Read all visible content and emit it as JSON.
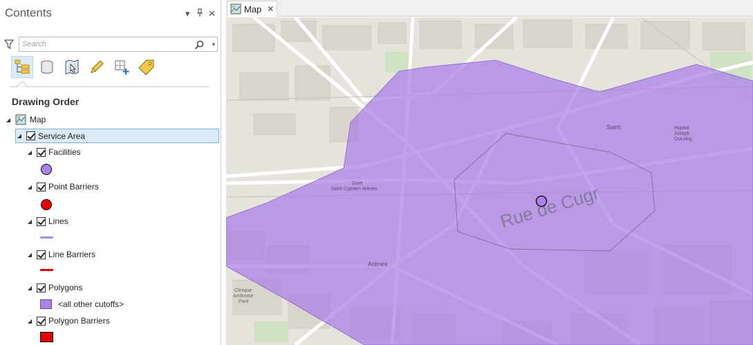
{
  "contents": {
    "title": "Contents",
    "controls": {
      "menu": "▾",
      "pin": "📌",
      "close": "✕"
    },
    "search": {
      "placeholder": "Search",
      "value": ""
    },
    "toolbar": [
      {
        "name": "list-by-drawing-order-icon",
        "active": true
      },
      {
        "name": "list-by-data-source-icon",
        "active": false
      },
      {
        "name": "list-by-selection-icon",
        "active": false
      },
      {
        "name": "list-by-editing-icon",
        "active": false
      },
      {
        "name": "list-by-snapping-icon",
        "active": false
      },
      {
        "name": "list-by-labeling-icon",
        "active": false
      }
    ],
    "heading": "Drawing Order",
    "tree": {
      "map": "Map",
      "service_area": "Service Area",
      "facilities": "Facilities",
      "point_barriers": "Point Barriers",
      "lines": "Lines",
      "line_barriers": "Line Barriers",
      "polygons": "Polygons",
      "polygons_class": "<all other cutoffs>",
      "polygon_barriers": "Polygon Barriers"
    }
  },
  "map_tab": {
    "label": "Map",
    "close": "✕"
  },
  "map": {
    "street_labels": {
      "rue_de_cugr": "Rue de Cugr",
      "saint": "Saint",
      "hopital": "Hopital",
      "joseph": "Joseph",
      "ducuing": "Ducuing",
      "gare": "Gare",
      "saint_cyprien": "Saint Cyprien-Arènes",
      "arenes": "Arènes",
      "clinique": "Clinique",
      "ambroise": "Ambroise",
      "pare": "Paré"
    }
  },
  "colors": {
    "service_area_fill": "#a77ee6",
    "facility": "#a982e8",
    "point_barrier": "#e60000",
    "line": "#a98ae8",
    "line_barrier": "#e60000",
    "polygon_class": "#a982e8",
    "polygon_barrier": "#e60000",
    "selection": "#dbeaf7"
  }
}
